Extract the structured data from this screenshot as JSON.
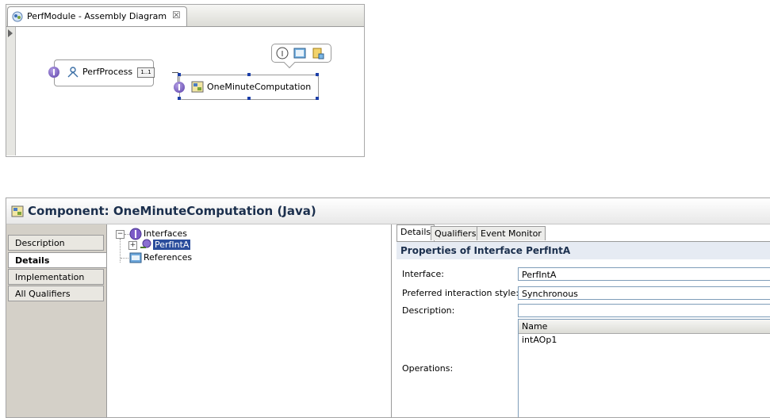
{
  "diagram": {
    "tab_title": "PerfModule - Assembly Diagram",
    "tab_close": "☒",
    "nodes": {
      "process": {
        "label": "PerfProcess",
        "ref_badge": "1..1"
      },
      "computation": {
        "label": "OneMinuteComputation"
      }
    }
  },
  "properties": {
    "title": "Component: OneMinuteComputation (Java)",
    "left_tabs": [
      {
        "label": "Description"
      },
      {
        "label": "Details"
      },
      {
        "label": "Implementation"
      },
      {
        "label": "All Qualifiers"
      }
    ],
    "tree": {
      "interfaces_label": "Interfaces",
      "interface_item": "PerfIntA",
      "references_label": "References"
    },
    "detail_tabs": [
      "Details",
      "Qualifiers",
      "Event Monitor"
    ],
    "section_heading": "Properties of Interface PerfIntA",
    "fields": {
      "interface_label": "Interface:",
      "interface_value": "PerfIntA",
      "style_label": "Preferred interaction style:",
      "style_value": "Synchronous",
      "description_label": "Description:",
      "description_value": "",
      "operations_label": "Operations:"
    },
    "operations_table": {
      "column": "Name",
      "rows": [
        "intAOp1"
      ]
    }
  }
}
